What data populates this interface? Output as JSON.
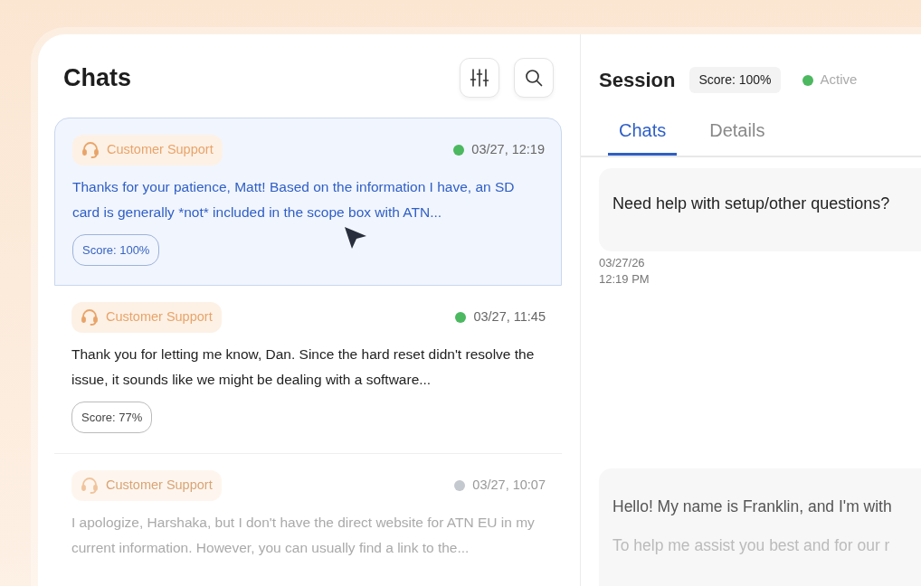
{
  "chats_panel": {
    "title": "Chats",
    "items": [
      {
        "tag": "Customer Support",
        "color": "#4cb860",
        "time": "03/27, 12:19",
        "preview": "Thanks for your patience, Matt! Based on the information I have, an SD card is generally *not* included in the scope box with ATN...",
        "score": "Score: 100%",
        "selected": true,
        "dimmed": false
      },
      {
        "tag": "Customer Support",
        "color": "#4cb860",
        "time": "03/27, 11:45",
        "preview": "Thank you for letting me know, Dan. Since the hard reset didn't resolve the issue, it sounds like we might be dealing with a software...",
        "score": "Score: 77%",
        "selected": false,
        "dimmed": false
      },
      {
        "tag": "Customer Support",
        "color": "#c4c8cf",
        "time": "03/27, 10:07",
        "preview": "I apologize, Harshaka, but I don't have the direct website for ATN EU in my current information. However, you can usually find a link to the...",
        "selected": false,
        "dimmed": true
      }
    ]
  },
  "session": {
    "title": "Session",
    "score": "Score: 100%",
    "status": "Active",
    "color": "#4cb860",
    "tabs": [
      {
        "label": "Chats",
        "selected": true
      },
      {
        "label": "Details",
        "selected": false
      }
    ],
    "messages": [
      {
        "lines": [
          {
            "text": "Need help with setup/other questions?",
            "dimmed": false
          }
        ],
        "timestamp": [
          "03/27/26",
          "12:19 PM"
        ]
      },
      {
        "lines": [
          {
            "text": "Hello! My name is Franklin, and I'm with",
            "dimmed": false
          },
          {
            "text": "To help me assist you best and for our r",
            "dimmed": true
          }
        ]
      }
    ]
  }
}
